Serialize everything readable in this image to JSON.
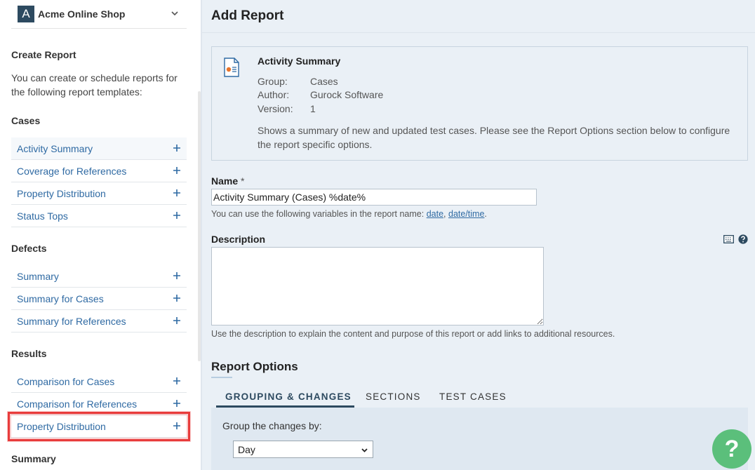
{
  "sidebar": {
    "project": {
      "badge": "A",
      "name": "Acme Online Shop"
    },
    "create_report_heading": "Create Report",
    "create_report_desc": "You can create or schedule reports for the following report templates:",
    "groups": {
      "cases": {
        "heading": "Cases",
        "items": [
          "Activity Summary",
          "Coverage for References",
          "Property Distribution",
          "Status Tops"
        ]
      },
      "defects": {
        "heading": "Defects",
        "items": [
          "Summary",
          "Summary for Cases",
          "Summary for References"
        ]
      },
      "results": {
        "heading": "Results",
        "items": [
          "Comparison for Cases",
          "Comparison for References",
          "Property Distribution"
        ]
      },
      "summary": {
        "heading": "Summary"
      }
    }
  },
  "main": {
    "title": "Add Report",
    "template": {
      "title": "Activity Summary",
      "group_label": "Group:",
      "group_value": "Cases",
      "author_label": "Author:",
      "author_value": "Gurock Software",
      "version_label": "Version:",
      "version_value": "1",
      "description": "Shows a summary of new and updated test cases. Please see the Report Options section below to configure the report specific options."
    },
    "name_field": {
      "label": "Name",
      "required_mark": "*",
      "value": "Activity Summary (Cases) %date%",
      "hint_prefix": "You can use the following variables in the report name:",
      "var_date": "date",
      "var_sep": ",",
      "var_datetime": "date/time",
      "hint_suffix": "."
    },
    "description_field": {
      "label": "Description",
      "hint": "Use the description to explain the content and purpose of this report or add links to additional resources."
    },
    "report_options": {
      "title": "Report Options",
      "tabs": [
        "GROUPING & CHANGES",
        "SECTIONS",
        "TEST CASES"
      ],
      "group_by_label": "Group the changes by:",
      "group_by_value": "Day"
    }
  },
  "help_fab": {
    "label": "?"
  },
  "colors": {
    "accent": "#2f6aa3",
    "highlight": "#e83b3b",
    "fab": "#5bbf7b",
    "badge": "#2d4a60"
  }
}
